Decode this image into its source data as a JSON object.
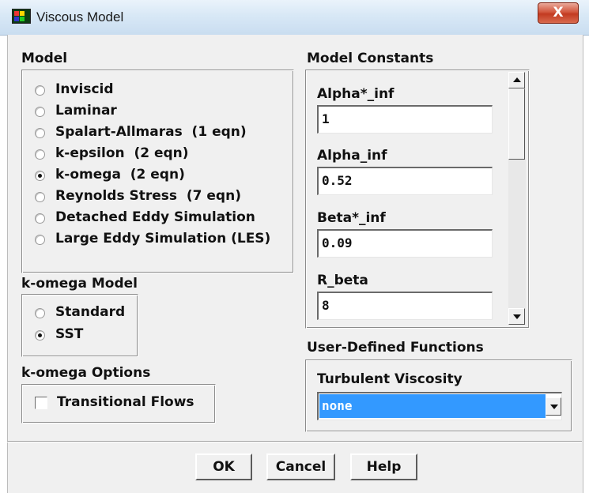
{
  "window": {
    "title": "Viscous Model",
    "close_glyph": "X"
  },
  "model": {
    "header": "Model",
    "options": [
      {
        "label": "Inviscid",
        "selected": false
      },
      {
        "label": "Laminar",
        "selected": false
      },
      {
        "label": "Spalart-Allmaras  (1 eqn)",
        "selected": false
      },
      {
        "label": "k-epsilon  (2 eqn)",
        "selected": false
      },
      {
        "label": "k-omega  (2 eqn)",
        "selected": true
      },
      {
        "label": "Reynolds Stress  (7 eqn)",
        "selected": false
      },
      {
        "label": "Detached Eddy Simulation",
        "selected": false
      },
      {
        "label": "Large Eddy Simulation (LES)",
        "selected": false
      }
    ]
  },
  "komega_model": {
    "header": "k-omega Model",
    "options": [
      {
        "label": "Standard",
        "selected": false
      },
      {
        "label": "SST",
        "selected": true
      }
    ]
  },
  "komega_options": {
    "header": "k-omega Options",
    "transitional_flows": {
      "label": "Transitional Flows",
      "checked": false
    }
  },
  "constants": {
    "header": "Model Constants",
    "items": [
      {
        "label": "Alpha*_inf",
        "value": "1"
      },
      {
        "label": "Alpha_inf",
        "value": "0.52"
      },
      {
        "label": "Beta*_inf",
        "value": "0.09"
      },
      {
        "label": "R_beta",
        "value": "8"
      }
    ]
  },
  "udf": {
    "header": "User-Defined Functions",
    "turbulent_viscosity": {
      "label": "Turbulent Viscosity",
      "selected": "none"
    }
  },
  "buttons": {
    "ok": "OK",
    "cancel": "Cancel",
    "help": "Help"
  },
  "colors": {
    "select_highlight": "#3399ff",
    "title_bar": "#d8e8f6",
    "close_button": "#c8442a"
  }
}
